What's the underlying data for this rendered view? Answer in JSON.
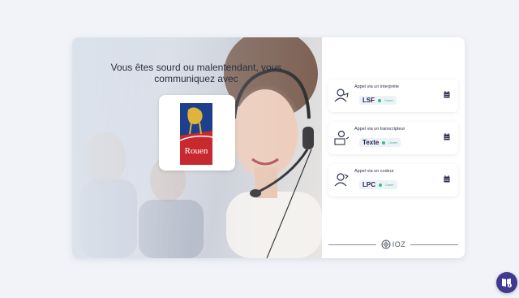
{
  "hero": {
    "title": "Vous êtes sourd ou malentendant, vous communiquez avec",
    "logo_text": "Rouen"
  },
  "calls": [
    {
      "label": "Appel via un interprète",
      "code": "LSF",
      "status": "Ouvert",
      "icon": "interpreter-icon"
    },
    {
      "label": "Appel via un transcripteur",
      "code": "Texte",
      "status": "Ouvert",
      "icon": "transcriber-icon"
    },
    {
      "label": "Appel via un codeur",
      "code": "LPC",
      "status": "Ouvert",
      "icon": "coder-icon"
    }
  ],
  "brand": {
    "name": "IOZ"
  },
  "colors": {
    "status_open": "#2ec27e",
    "fab": "#3f3a8f",
    "rouen_red": "#c8292e",
    "rouen_blue": "#1e3f8c"
  }
}
